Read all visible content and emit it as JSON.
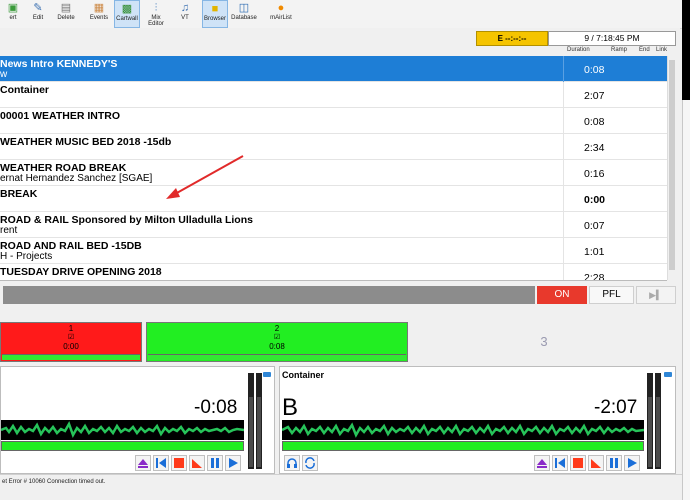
{
  "toolbar": {
    "items": [
      {
        "label": "ert",
        "icon": "insert-icon"
      },
      {
        "label": "Edit",
        "icon": "pencil-icon"
      },
      {
        "label": "Delete",
        "icon": "delete-icon"
      },
      {
        "label": "Events",
        "icon": "calendar-icon"
      },
      {
        "label": "Cartwall",
        "icon": "cartwall-icon"
      },
      {
        "label": "Mix Editor",
        "icon": "mixer-icon"
      },
      {
        "label": "VT",
        "icon": "microphone-icon"
      },
      {
        "label": "Browser",
        "icon": "folder-icon"
      },
      {
        "label": "Database",
        "icon": "database-icon"
      },
      {
        "label": "mAirList",
        "icon": "mairlist-icon"
      }
    ]
  },
  "timebar": {
    "e_label": "E  --:--:--",
    "clock": "9 / 7:18:45 PM"
  },
  "columns": {
    "duration": "Duration",
    "ramp": "Ramp",
    "end": "End",
    "link": "Link"
  },
  "playlist": [
    {
      "title": "News Intro KENNEDY'S",
      "subtitle": "w",
      "duration": "0:08",
      "selected": true
    },
    {
      "title": "Container",
      "subtitle": "",
      "duration": "2:07"
    },
    {
      "title": "00001 WEATHER INTRO",
      "subtitle": "",
      "duration": "0:08"
    },
    {
      "title": "WEATHER MUSIC BED 2018 -15db",
      "subtitle": "",
      "duration": "2:34"
    },
    {
      "title": "WEATHER ROAD BREAK",
      "subtitle": "ernat  Hernandez Sanchez [SGAE]",
      "duration": "0:16"
    },
    {
      "title": "BREAK",
      "subtitle": "",
      "duration": "0:00",
      "bold_duration": true
    },
    {
      "title": "ROAD & RAIL Sponsored by Milton Ulladulla Lions",
      "subtitle": "rent",
      "duration": "0:07"
    },
    {
      "title": "ROAD AND RAIL BED -15DB",
      "subtitle": "H - Projects",
      "duration": "1:01"
    },
    {
      "title": "TUESDAY DRIVE OPENING 2018",
      "subtitle": "",
      "duration": "2:28"
    }
  ],
  "controls": {
    "on_label": "ON",
    "pfl_label": "PFL",
    "skip_icon": "skip-end-icon"
  },
  "cartwall": {
    "cart1": {
      "number": "1",
      "time": "0:00",
      "color": "#ff1a1a"
    },
    "cart2": {
      "number": "2",
      "time": "0:08",
      "color": "#22ee22"
    },
    "cart3": {
      "number": "3"
    }
  },
  "playerA": {
    "time": "-0:08"
  },
  "playerB": {
    "name": "Container",
    "letter": "B",
    "time": "-2:07"
  },
  "status": {
    "text": "et Error # 10060  Connection timed out."
  }
}
